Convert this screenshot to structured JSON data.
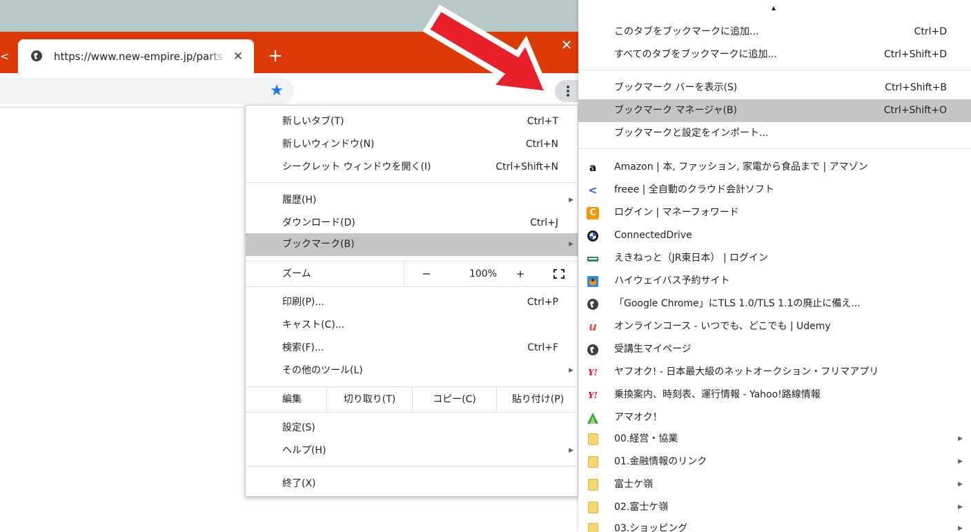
{
  "tab": {
    "title": "https://www.new-empire.jp/parts",
    "left_edge": "<",
    "close": "✕",
    "new_tab": "+",
    "window_close": "✕"
  },
  "menu": {
    "new_tab": {
      "label": "新しいタブ(T)",
      "shortcut": "Ctrl+T"
    },
    "new_window": {
      "label": "新しいウィンドウ(N)",
      "shortcut": "Ctrl+N"
    },
    "incognito": {
      "label": "シークレット ウィンドウを開く(I)",
      "shortcut": "Ctrl+Shift+N"
    },
    "history": {
      "label": "履歴(H)"
    },
    "downloads": {
      "label": "ダウンロード(D)",
      "shortcut": "Ctrl+J"
    },
    "bookmarks": {
      "label": "ブックマーク(B)"
    },
    "zoom": {
      "label": "ズーム",
      "minus": "−",
      "value": "100%",
      "plus": "+"
    },
    "print": {
      "label": "印刷(P)...",
      "shortcut": "Ctrl+P"
    },
    "cast": {
      "label": "キャスト(C)..."
    },
    "find": {
      "label": "検索(F)...",
      "shortcut": "Ctrl+F"
    },
    "more_tools": {
      "label": "その他のツール(L)"
    },
    "edit": {
      "label": "編集",
      "cut": "切り取り(T)",
      "copy": "コピー(C)",
      "paste": "貼り付け(P)"
    },
    "settings": {
      "label": "設定(S)"
    },
    "help": {
      "label": "ヘルプ(H)"
    },
    "exit": {
      "label": "終了(X)"
    }
  },
  "bookmarks": {
    "add_tab": {
      "label": "このタブをブックマークに追加...",
      "shortcut": "Ctrl+D"
    },
    "add_all": {
      "label": "すべてのタブをブックマークに追加...",
      "shortcut": "Ctrl+Shift+D"
    },
    "show_bar": {
      "label": "ブックマーク バーを表示(S)",
      "shortcut": "Ctrl+Shift+B"
    },
    "manager": {
      "label": "ブックマーク マネージャ(B)",
      "shortcut": "Ctrl+Shift+O"
    },
    "import": {
      "label": "ブックマークと設定をインポート..."
    },
    "items": [
      {
        "label": "Amazon | 本, ファッション, 家電から食品まで | アマゾン",
        "icon": "amazon-icon",
        "glyph": "a"
      },
      {
        "label": "freee | 全自動のクラウド会計ソフト",
        "icon": "freee-icon",
        "glyph": "<"
      },
      {
        "label": "ログイン | マネーフォワード",
        "icon": "moneyforward-icon",
        "glyph": "C"
      },
      {
        "label": "ConnectedDrive",
        "icon": "bmw-icon",
        "glyph": ""
      },
      {
        "label": "えきねっと（JR東日本） | ログイン",
        "icon": "ekinet-icon",
        "glyph": ""
      },
      {
        "label": "ハイウェイバス予約サイト",
        "icon": "highwaybus-icon",
        "glyph": ""
      },
      {
        "label": "「Google Chrome」にTLS 1.0/TLS 1.1の廃止に備え...",
        "icon": "globe-icon",
        "glyph": ""
      },
      {
        "label": "オンラインコース - いつでも、どこでも | Udemy",
        "icon": "udemy-icon",
        "glyph": "u"
      },
      {
        "label": "受講生マイページ",
        "icon": "globe-icon",
        "glyph": ""
      },
      {
        "label": "ヤフオク! - 日本最大級のネットオークション・フリマアプリ",
        "icon": "yahoo-icon",
        "glyph": "Y!"
      },
      {
        "label": "乗換案内、時刻表、運行情報 - Yahoo!路線情報",
        "icon": "yahoo-icon",
        "glyph": "Y!"
      },
      {
        "label": "アマオク！",
        "icon": "amaoku-icon",
        "glyph": ""
      }
    ],
    "folders": [
      {
        "label": "00.経営・協業"
      },
      {
        "label": "01.金融情報のリンク"
      },
      {
        "label": "富士ケ嶺"
      },
      {
        "label": "02.富士ケ嶺"
      },
      {
        "label": "03.ショッピング"
      }
    ]
  },
  "colors": {
    "tabstrip": "#dc3a06",
    "highlight": "#c5c5c5",
    "arrow": "#e8202a",
    "star": "#1a73e8"
  }
}
